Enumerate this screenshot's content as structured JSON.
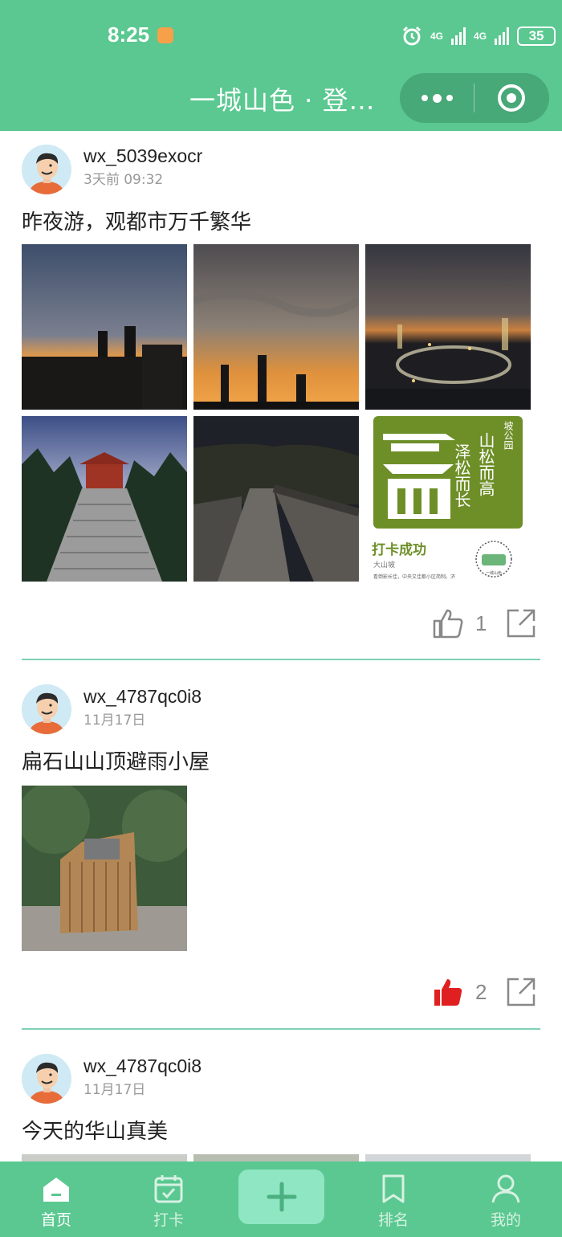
{
  "status_bar": {
    "time": "8:25",
    "network_1": "4G",
    "network_2": "4G",
    "battery": "35"
  },
  "nav": {
    "title": "一城山色 · 登…"
  },
  "posts": [
    {
      "username": "wx_5039exocr",
      "time": "3天前 09:32",
      "content": "昨夜游，观都市万千繁华",
      "like_count": "1",
      "liked": false,
      "images": [
        "city-dusk-1",
        "city-dusk-2",
        "city-night-aerial",
        "pavilion-stairs",
        "great-wall-night",
        "checkin-card"
      ],
      "checkin_card": {
        "calligraphy_line1": "山松而高",
        "calligraphy_line2": "泽松而长",
        "badge": "坡公园",
        "success_text": "打卡成功",
        "location": "大山坡",
        "footer": "看倒影长佳，中央又佳都小区简制。济",
        "logo_text": "一城山色"
      }
    },
    {
      "username": "wx_4787qc0i8",
      "time": "11月17日",
      "content": "扁石山山顶避雨小屋",
      "like_count": "2",
      "liked": true,
      "images": [
        "wooden-hut"
      ]
    },
    {
      "username": "wx_4787qc0i8",
      "time": "11月17日",
      "content": "今天的华山真美",
      "images": [
        "mountain-1",
        "mountain-2",
        "mountain-3"
      ]
    }
  ],
  "tabbar": {
    "items": [
      {
        "label": "首页",
        "icon": "home-icon"
      },
      {
        "label": "打卡",
        "icon": "calendar-check-icon"
      },
      {
        "label": "",
        "icon": "plus-icon"
      },
      {
        "label": "排名",
        "icon": "bookmark-icon"
      },
      {
        "label": "我的",
        "icon": "user-icon"
      }
    ]
  },
  "colors": {
    "brand": "#5ac890",
    "capsule": "#47a878",
    "divider": "#7fcfb6",
    "liked": "#e02020"
  }
}
